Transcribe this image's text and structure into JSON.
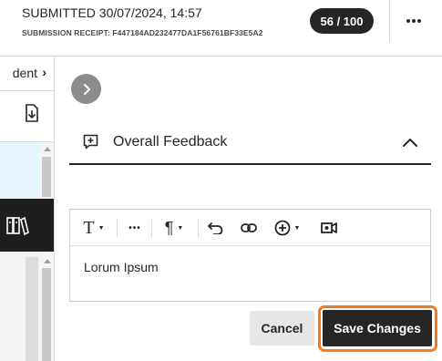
{
  "header": {
    "submitted_text": "SUBMITTED 30/07/2024, 14:57",
    "receipt_text": "SUBMISSION RECEIPT: F447184AD232477DA1F56761BF33E5A2",
    "score": "56 / 100",
    "more_icon": "more-horizontal-icon"
  },
  "left_strip": {
    "student_tab_label": "dent",
    "student_tab_chevron": "›",
    "download_icon": "download-icon",
    "book_icon": "library-book-icon"
  },
  "feedback": {
    "expand_icon": "chevron-right-icon",
    "title": "Overall Feedback",
    "collapse_icon": "chevron-up-icon"
  },
  "editor": {
    "toolbar": {
      "text_format_label": "T",
      "more_label": "•••",
      "paragraph_label": "¶",
      "caret": "▼"
    },
    "content": "Lorum Ipsum"
  },
  "actions": {
    "cancel_label": "Cancel",
    "save_label": "Save Changes"
  },
  "colors": {
    "dark": "#262626",
    "highlight_outline": "#f07a1c",
    "light_blue": "#e6f5fb"
  }
}
